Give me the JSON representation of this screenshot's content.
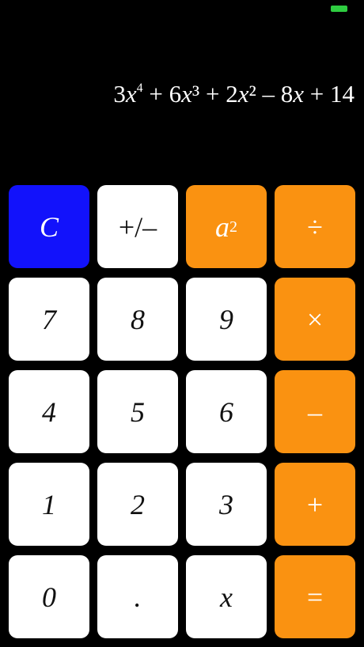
{
  "status": {
    "battery_color": "#2ecc40"
  },
  "display": {
    "expression_parts": {
      "c1": "3",
      "v1": "x",
      "e1": "4",
      "op1": " + ",
      "c2": "6",
      "v2": "x",
      "e2": "³",
      "op2": " + ",
      "c3": "2",
      "v3": "x",
      "e3": "²",
      "op3": " – ",
      "c4": "8",
      "v4": "x",
      "op4": " + ",
      "c5": "14"
    }
  },
  "keys": {
    "clear": "C",
    "sign": "+/–",
    "square_base": "a",
    "square_exp": "2",
    "divide": "÷",
    "seven": "7",
    "eight": "8",
    "nine": "9",
    "multiply": "×",
    "four": "4",
    "five": "5",
    "six": "6",
    "subtract": "–",
    "one": "1",
    "two": "2",
    "three": "3",
    "add": "+",
    "zero": "0",
    "dot": ".",
    "variable": "x",
    "equals": "="
  },
  "colors": {
    "white_key": "#ffffff",
    "orange_key": "#fa9211",
    "clear_key": "#1212fb",
    "background": "#000000"
  }
}
